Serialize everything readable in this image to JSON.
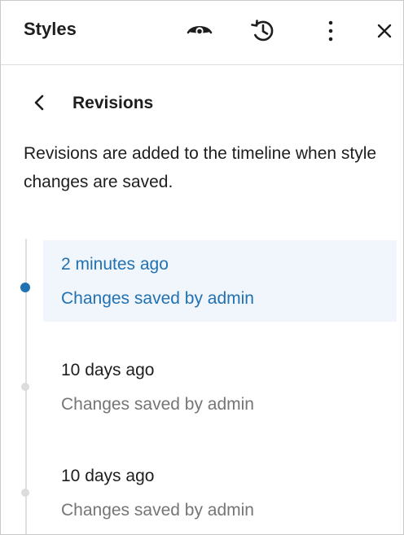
{
  "header": {
    "title": "Styles",
    "icons": [
      "eye-icon",
      "history-icon",
      "more-vertical-icon",
      "close-icon"
    ]
  },
  "nav": {
    "back_icon": "chevron-left-icon",
    "title": "Revisions"
  },
  "description": "Revisions are added to the timeline when style changes are saved.",
  "revisions": [
    {
      "date": "2 minutes ago",
      "author": "Changes saved by admin",
      "selected": true
    },
    {
      "date": "10 days ago",
      "author": "Changes saved by admin",
      "selected": false
    },
    {
      "date": "10 days ago",
      "author": "Changes saved by admin",
      "selected": false
    }
  ],
  "colors": {
    "accent": "#2271b1",
    "selected_bg": "#f0f6fc",
    "muted_text": "#757575",
    "timeline": "#e0e0e0"
  }
}
